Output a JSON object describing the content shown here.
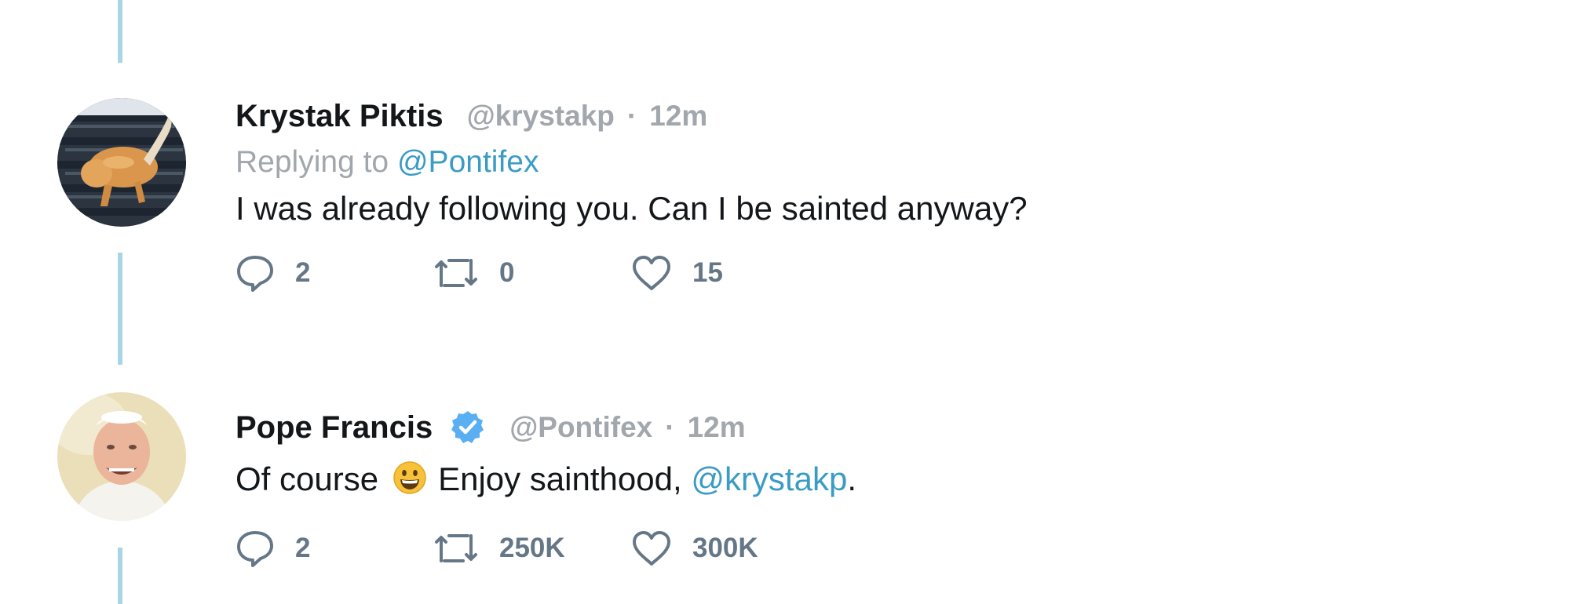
{
  "tweets": [
    {
      "name": "Krystak Piktis",
      "handle": "@krystakp",
      "separator": "·",
      "time": "12m",
      "verified": false,
      "replying_prefix": "Replying to",
      "replying_to": "@Pontifex",
      "text": "I was already following you. Can I be sainted anyway?",
      "reply_count": "2",
      "retweet_count": "0",
      "like_count": "15",
      "avatar_icon": "cat-avatar"
    },
    {
      "name": "Pope Francis",
      "handle": "@Pontifex",
      "separator": "·",
      "time": "12m",
      "verified": true,
      "text_part1": "Of course",
      "emoji_icon": "grinning-face-emoji",
      "text_part2": "Enjoy sainthood,",
      "text_mention": "@krystakp",
      "text_end": ".",
      "reply_count": "2",
      "retweet_count": "250K",
      "like_count": "300K",
      "avatar_icon": "pope-avatar"
    }
  ],
  "colors": {
    "thread_line": "#a8d6e4",
    "mention": "#3a9cc4",
    "muted": "#a1a7ac",
    "action": "#657786",
    "verified_badge": "#5aaef2"
  }
}
